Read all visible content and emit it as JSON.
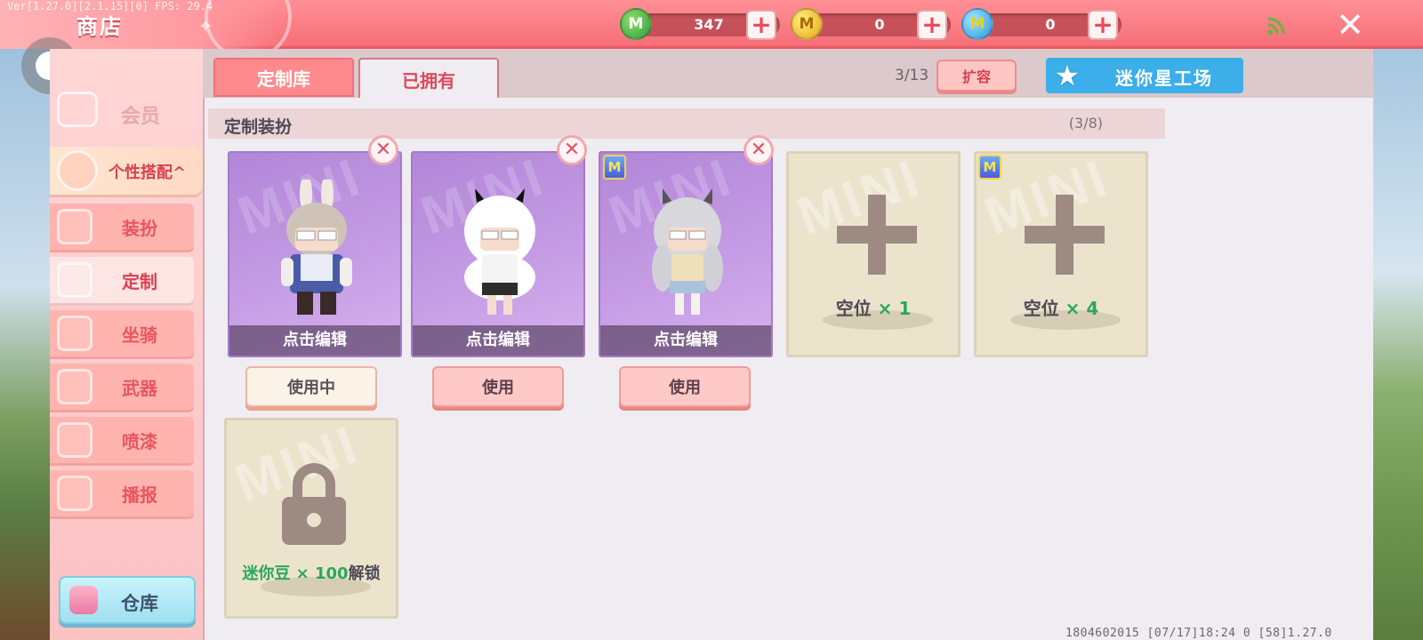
{
  "meta": {
    "version": "Ver[1.27.0][2.1.15][0] FPS: 29.4"
  },
  "header": {
    "title": "商店"
  },
  "currencies": [
    {
      "icon": "green-mini-coin-icon",
      "glyph": "M",
      "value": "347"
    },
    {
      "icon": "gold-coin-icon",
      "glyph": "M",
      "value": "0"
    },
    {
      "icon": "blue-mini-coin-icon",
      "glyph": "M",
      "value": "0"
    }
  ],
  "controls": {
    "plus": "+",
    "close": "✕"
  },
  "sidebar": {
    "member": "会员",
    "group": "个性搭配",
    "group_arrow": "^",
    "items": [
      {
        "label": "装扮"
      },
      {
        "label": "定制"
      },
      {
        "label": "坐骑"
      },
      {
        "label": "武器"
      },
      {
        "label": "喷漆"
      },
      {
        "label": "播报"
      }
    ],
    "warehouse": "仓库"
  },
  "tabs": [
    {
      "label": "定制库",
      "active": false
    },
    {
      "label": "已拥有",
      "active": true
    }
  ],
  "toolbar": {
    "capacity": "3/13",
    "expand": "扩容",
    "workshop": "迷你星工场",
    "workshop_star": "★"
  },
  "section": {
    "title": "定制装扮",
    "count": "(3/8)"
  },
  "outfits": [
    {
      "edit": "点击编辑",
      "action": "使用中",
      "delete": "✕"
    },
    {
      "edit": "点击编辑",
      "action": "使用",
      "delete": "✕"
    },
    {
      "edit": "点击编辑",
      "action": "使用",
      "delete": "✕",
      "badge": "M"
    }
  ],
  "empty_slots": [
    {
      "prefix": "空位",
      "count": "× 1"
    },
    {
      "prefix": "空位",
      "count": "× 4",
      "badge": "M"
    }
  ],
  "locked_slot": {
    "currency": "迷你豆 × 100",
    "suffix": "解锁"
  },
  "watermark": "MINI",
  "footer": "1804602015   [07/17]18:24 0   [58]1.27.0"
}
